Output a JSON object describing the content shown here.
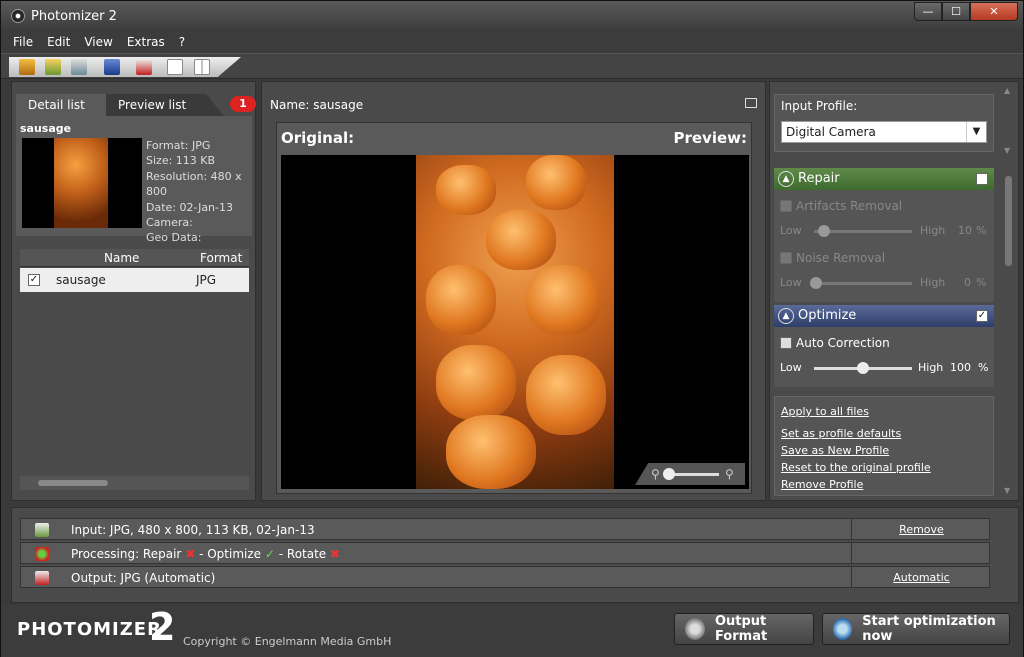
{
  "window": {
    "title": "Photomizer 2",
    "min": "—",
    "max": "☐",
    "close": "✕"
  },
  "menu": [
    "File",
    "Edit",
    "View",
    "Extras",
    "?"
  ],
  "left": {
    "tabs": {
      "detail": "Detail list",
      "preview": "Preview list",
      "count": "1"
    },
    "file_name": "sausage",
    "meta": {
      "format": "Format: JPG",
      "size": "Size: 113 KB",
      "resolution": "Resolution: 480 x 800",
      "date": "Date: 02-Jan-13",
      "camera": "Camera:",
      "geo": "Geo Data:"
    },
    "list": {
      "col_name": "Name",
      "col_format": "Format",
      "rows": [
        {
          "name": "sausage",
          "format": "JPG",
          "checked": "✓"
        }
      ]
    }
  },
  "center": {
    "name_label": "Name: sausage",
    "original": "Original:",
    "preview": "Preview:"
  },
  "right": {
    "input_profile_label": "Input Profile:",
    "input_profile_value": "Digital Camera",
    "repair": {
      "title": "Repair",
      "artifacts": "Artifacts Removal",
      "noise": "Noise Removal",
      "low": "Low",
      "high": "High",
      "artifacts_value": "10",
      "noise_value": "0",
      "pct": "%"
    },
    "optimize": {
      "title": "Optimize",
      "checked": "✓",
      "auto": "Auto Correction",
      "low": "Low",
      "high": "High",
      "value": "100",
      "pct": "%",
      "level": 0.5
    },
    "links": {
      "apply_all": "Apply to all files",
      "set_defaults": "Set as profile defaults",
      "save_new": "Save as New Profile",
      "reset": "Reset to the original profile",
      "remove": "Remove Profile"
    }
  },
  "bottom": {
    "input": "Input: JPG, 480 x 800, 113 KB, 02-Jan-13",
    "input_action": "Remove",
    "processing_pre": "Processing: Repair",
    "processing_mid1": "- Optimize",
    "processing_mid2": "- Rotate",
    "mark_x": "✖",
    "mark_ok": "✓",
    "output": "Output: JPG (Automatic)",
    "output_action": "Automatic"
  },
  "footer": {
    "logo": "PHOTOMIZER",
    "logo_num": "2",
    "copyright": "Copyright © Engelmann Media GmbH",
    "output_format_btn": "Output Format",
    "start_btn": "Start optimization now"
  },
  "colors": {
    "accent_red": "#dd2222",
    "repair_green": "#4e7a3c",
    "optimize_blue": "#3e4e7e"
  }
}
